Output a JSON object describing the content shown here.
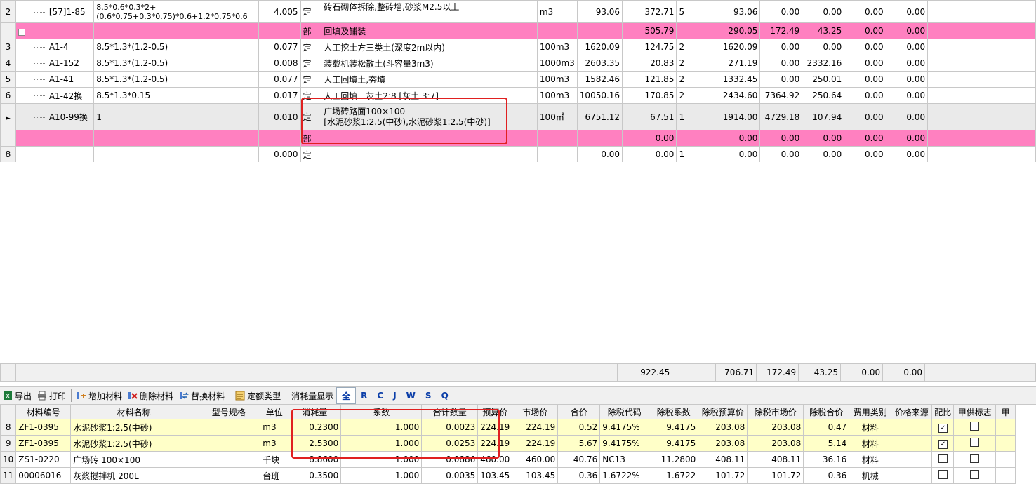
{
  "top_table": {
    "rows": [
      {
        "num": "2",
        "code": "[57]1-85",
        "expr": "8.5*0.6*0.3*2+(0.6*0.75+0.3*0.75)*0.6+1.2*0.75*0.6",
        "qty": "4.005",
        "type": "定",
        "name": "砖石砌体拆除,整砖墙,砂浆M2.5以上",
        "unit": "m3",
        "price": "93.06",
        "total": "372.71",
        "n": "5",
        "c1": "93.06",
        "c2": "0.00",
        "c3": "0.00",
        "c4": "0.00",
        "c5": "0.00"
      },
      {
        "num": "",
        "code": "",
        "expr": "",
        "qty": "",
        "type": "部",
        "name": "回填及铺装",
        "unit": "",
        "price": "",
        "total": "505.79",
        "n": "",
        "c1": "290.05",
        "c2": "172.49",
        "c3": "43.25",
        "c4": "0.00",
        "c5": "0.00"
      },
      {
        "num": "3",
        "code": "A1-4",
        "expr": "8.5*1.3*(1.2-0.5)",
        "qty": "0.077",
        "type": "定",
        "name": "人工挖土方三类土(深度2m以内)",
        "unit": "100m3",
        "price": "1620.09",
        "total": "124.75",
        "n": "2",
        "c1": "1620.09",
        "c2": "0.00",
        "c3": "0.00",
        "c4": "0.00",
        "c5": "0.00"
      },
      {
        "num": "4",
        "code": "A1-152",
        "expr": "8.5*1.3*(1.2-0.5)",
        "qty": "0.008",
        "type": "定",
        "name": "装载机装松散土(斗容量3m3)",
        "unit": "1000m3",
        "price": "2603.35",
        "total": "20.83",
        "n": "2",
        "c1": "271.19",
        "c2": "0.00",
        "c3": "2332.16",
        "c4": "0.00",
        "c5": "0.00"
      },
      {
        "num": "5",
        "code": "A1-41",
        "expr": "8.5*1.3*(1.2-0.5)",
        "qty": "0.077",
        "type": "定",
        "name": "人工回填土,夯填",
        "unit": "100m3",
        "price": "1582.46",
        "total": "121.85",
        "n": "2",
        "c1": "1332.45",
        "c2": "0.00",
        "c3": "250.01",
        "c4": "0.00",
        "c5": "0.00"
      },
      {
        "num": "6",
        "code": "A1-42换",
        "expr": "8.5*1.3*0.15",
        "qty": "0.017",
        "type": "定",
        "name": "人工回填　灰土2:8 [灰土 3:7]",
        "unit": "100m3",
        "price": "10050.16",
        "total": "170.85",
        "n": "2",
        "c1": "2434.60",
        "c2": "7364.92",
        "c3": "250.64",
        "c4": "0.00",
        "c5": "0.00"
      },
      {
        "num": "",
        "code": "A10-99换",
        "expr": "1",
        "qty": "0.010",
        "type": "定",
        "name": "广场砖路面100×100",
        "name2": "[水泥砂浆1:2.5(中砂),水泥砂浆1:2.5(中砂)]",
        "unit": "100㎡",
        "price": "6751.12",
        "total": "67.51",
        "n": "1",
        "c1": "1914.00",
        "c2": "4729.18",
        "c3": "107.94",
        "c4": "0.00",
        "c5": "0.00"
      },
      {
        "num": "",
        "code": "",
        "expr": "",
        "qty": "",
        "type": "部",
        "name": "",
        "unit": "",
        "price": "",
        "total": "0.00",
        "n": "",
        "c1": "0.00",
        "c2": "0.00",
        "c3": "0.00",
        "c4": "0.00",
        "c5": "0.00"
      },
      {
        "num": "8",
        "code": "",
        "expr": "",
        "qty": "0.000",
        "type": "定",
        "name": "",
        "unit": "",
        "price": "0.00",
        "total": "0.00",
        "n": "1",
        "c1": "0.00",
        "c2": "0.00",
        "c3": "0.00",
        "c4": "0.00",
        "c5": "0.00"
      }
    ],
    "summary": {
      "total": "922.45",
      "c1": "706.71",
      "c2": "172.49",
      "c3": "43.25",
      "c4": "0.00",
      "c5": "0.00"
    }
  },
  "toolbar": {
    "export": "导出",
    "print": "打印",
    "add": "增加材料",
    "delete": "删除材料",
    "replace": "替换材料",
    "quota_type": "定额类型",
    "consume_label": "消耗量显示",
    "letters": [
      "全",
      "R",
      "C",
      "J",
      "W",
      "S",
      "Q"
    ]
  },
  "material_table": {
    "headers": [
      "材料编号",
      "材料名称",
      "型号规格",
      "单位",
      "消耗量",
      "系数",
      "合计数量",
      "预算价",
      "市场价",
      "合价",
      "除税代码",
      "除税系数",
      "除税预算价",
      "除税市场价",
      "除税合价",
      "费用类别",
      "价格来源",
      "配比",
      "甲供标志",
      "甲"
    ],
    "rows": [
      {
        "num": "8",
        "code": "ZF1-0395",
        "name": "水泥砂浆1:2.5(中砂)",
        "spec": "",
        "unit": "m3",
        "consume": "0.2300",
        "coef": "1.000",
        "total_qty": "0.0023",
        "budget": "224.19",
        "market": "224.19",
        "amount": "0.52",
        "tax_code": "9.4175%",
        "tax_coef": "9.4175",
        "tax_budget": "203.08",
        "tax_market": "203.08",
        "tax_amount": "0.47",
        "fee": "材料",
        "source": "",
        "ratio": true,
        "supply": false
      },
      {
        "num": "9",
        "code": "ZF1-0395",
        "name": "水泥砂浆1:2.5(中砂)",
        "spec": "",
        "unit": "m3",
        "consume": "2.5300",
        "coef": "1.000",
        "total_qty": "0.0253",
        "budget": "224.19",
        "market": "224.19",
        "amount": "5.67",
        "tax_code": "9.4175%",
        "tax_coef": "9.4175",
        "tax_budget": "203.08",
        "tax_market": "203.08",
        "tax_amount": "5.14",
        "fee": "材料",
        "source": "",
        "ratio": true,
        "supply": false
      },
      {
        "num": "10",
        "code": "ZS1-0220",
        "name": "广场砖 100×100",
        "spec": "",
        "unit": "千块",
        "consume": "8.8600",
        "coef": "1.000",
        "total_qty": "0.0886",
        "budget": "460.00",
        "market": "460.00",
        "amount": "40.76",
        "tax_code": "NC13",
        "tax_coef": "11.2800",
        "tax_budget": "408.11",
        "tax_market": "408.11",
        "tax_amount": "36.16",
        "fee": "材料",
        "source": "",
        "ratio": false,
        "supply": false
      },
      {
        "num": "11",
        "code": "00006016-",
        "name": "灰浆搅拌机 200L",
        "spec": "",
        "unit": "台班",
        "consume": "0.3500",
        "coef": "1.000",
        "total_qty": "0.0035",
        "budget": "103.45",
        "market": "103.45",
        "amount": "0.36",
        "tax_code": "1.6722%",
        "tax_coef": "1.6722",
        "tax_budget": "101.72",
        "tax_market": "101.72",
        "tax_amount": "0.36",
        "fee": "机械",
        "source": "",
        "ratio": false,
        "supply": false
      }
    ]
  }
}
